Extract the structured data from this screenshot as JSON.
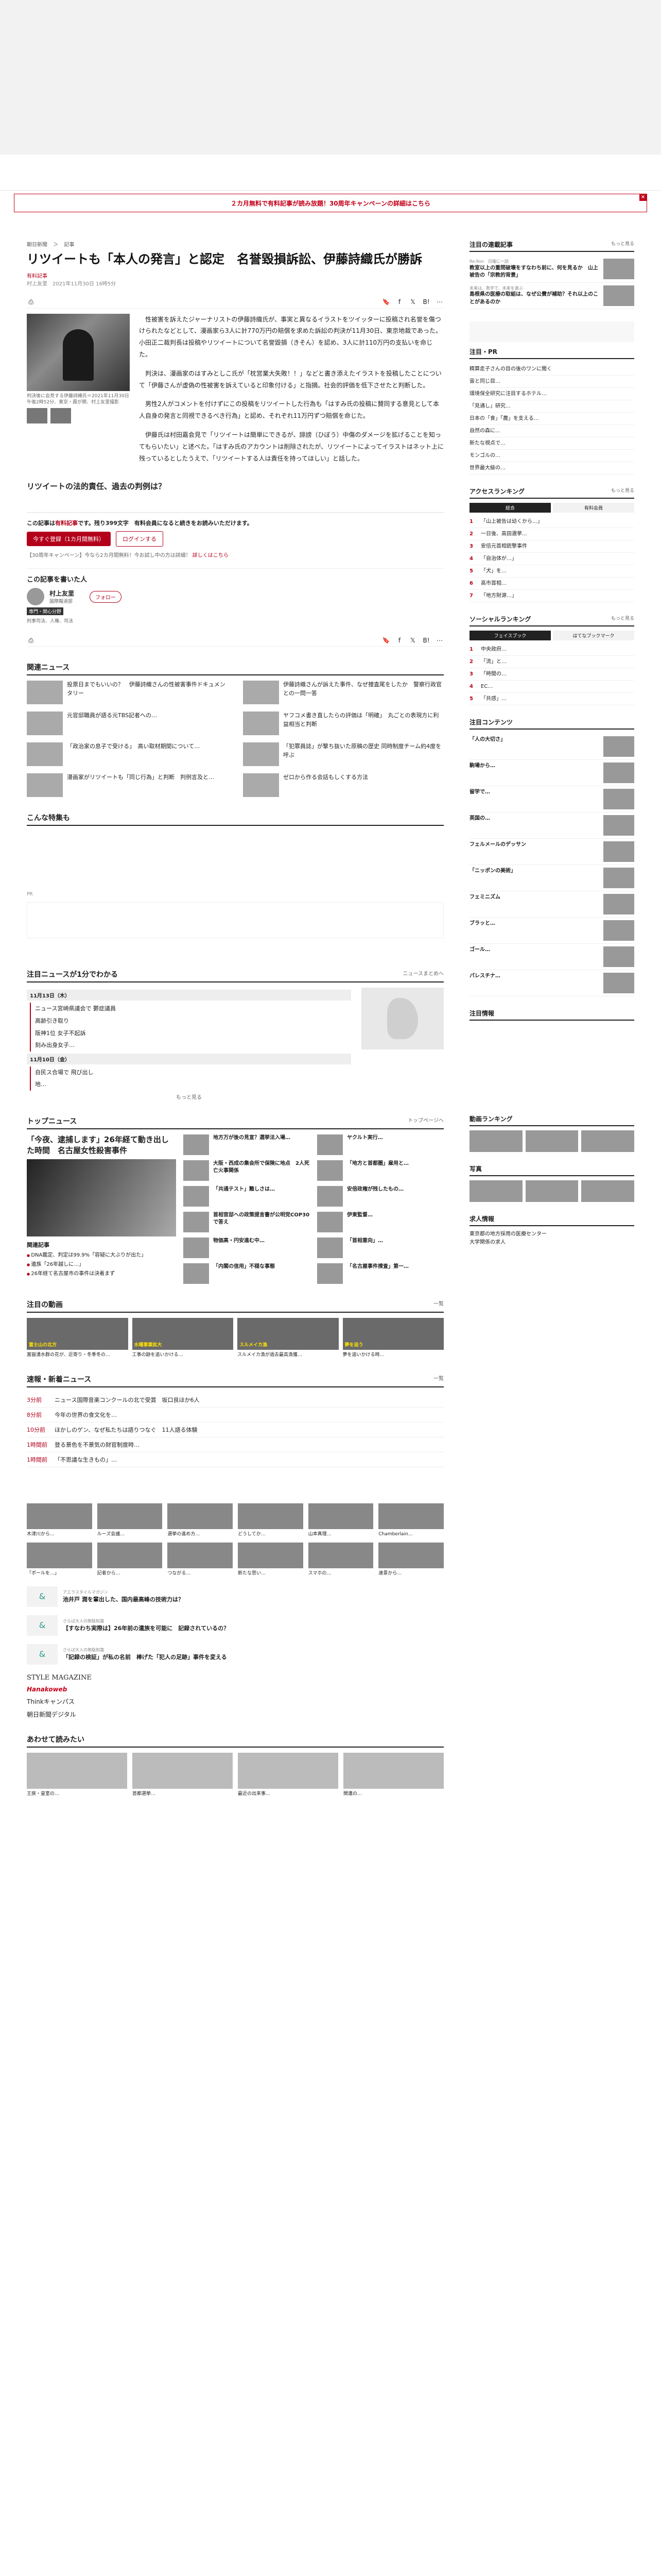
{
  "promo": {
    "text": "２カ月無料で有料記事が読み放題！30周年キャンペーンの詳細はこちら",
    "close": "×"
  },
  "breadcrumb": [
    "朝日新聞",
    "＞",
    "記事"
  ],
  "article": {
    "title": "リツイートも「本人の発言」と認定　名誉毀損訴訟、伊藤詩織氏が勝訴",
    "pay_label": "有料記事",
    "meta": "村上友里　2021年11月30日 16時5分",
    "caption": "判決後に会見する伊藤詩織氏＝2021年11月30日午後2時52分、東京・霞が関、村上友里撮影",
    "paragraphs": [
      "性被害を訴えたジャーナリストの伊藤詩織氏が、事実と異なるイラストをツイッターに投稿され名誉を傷つけられたなどとして、漫画家ら3人に計770万円の賠償を求めた訴訟の判決が11月30日、東京地裁であった。小田正二裁判長は投稿やリツイートについて名誉毀損（きそん）を認め、3人に計110万円の支払いを命じた。",
      "判決は、漫画家のはすみとしこ氏が「枕営業大失敗！！」などと書き添えたイラストを投稿したことについて「伊藤さんが虚偽の性被害を訴えていると印象付ける」と指摘。社会的評価を低下させたと判断した。",
      "男性2人がコメントを付けずにこの投稿をリツイートした行為も「はすみ氏の投稿に賛同する意見として本人自身の発言と同視できるべき行為」と認め、それぞれ11万円ずつ賠償を命じた。",
      "伊藤氏は村田嘉会見で「リツイートは簡単にできるが、誹謗（ひぼう）中傷のダメージを拡げることを知ってもらいたい」と述べた。「はすみ氏のアカウントは削除されたが、リツイートによってイラストはネット上に残っているとしたうえで、「リツイートする人は責任を持ってほしい」と話した。"
    ],
    "section_heading": "リツイートの法的責任、過去の判例は？",
    "paywall": {
      "text_prefix": "この記事は",
      "text_bold": "有料記事",
      "text_suffix": "です。残り399文字　有料会員になると続きをお読みいただけます。",
      "subscribe_label": "今すぐ登録（1カ月間無料）",
      "login_label": "ログインする",
      "note1": "【30周年キャンペーン】今なら2カ月間無料！今お試し中の方は詳細！",
      "note2": "詳しくはこちら"
    },
    "writer": {
      "heading": "この記事を書いた人",
      "name": "村上友里",
      "role": "国際報道部",
      "tag": "専門・関心分野",
      "area": "刑事司法、人権、司法",
      "follow_label": "フォロー"
    }
  },
  "share_icons": [
    "print-icon",
    "bookmark-icon",
    "facebook-icon",
    "x-icon",
    "hatena-icon",
    "more-icon"
  ],
  "related": {
    "heading": "関連ニュース",
    "items": [
      "投票日までもいいの？　伊藤詩織さんの性被害事件ドキュメンタリー",
      "伊藤詩織さんが訴えた事件、なぜ捜査尾をしたか　警察行政官との一問一答",
      "元官邸職員が語る元TBS記者への…",
      "ヤフコメ書き直したらの評価は「明確」　丸ごとの表現方に利益相当と判断",
      "「政治家の息子で受ける」　高い取材期間について…",
      "「犯罪員誌」が撃ち抜いた原稿の歴史 同時制度チーム約4度を呼ぶ",
      "漫画家がリツイートも「同じ行為」と判断　判例言及と…",
      "ゼロから作る会話もしくする方法"
    ]
  },
  "special": {
    "heading": "こんな特集も",
    "ad_label": "PR"
  },
  "timeline": {
    "heading": "注目ニュースが1分でわかる",
    "more": "ニュースまとめへ",
    "days": [
      {
        "label": "11月13日（木）",
        "items": [
          "ニュース宮崎県議会で 鬱症議員",
          "高齢引き取り",
          "阪神1位 女子不起訴",
          "刻み出身女子…"
        ]
      },
      {
        "label": "11月10日（金）",
        "items": [
          "自民ス合場で 飛び出し",
          "地…"
        ]
      }
    ],
    "show_more": "もっと見る"
  },
  "top_news": {
    "heading": "トップニュース",
    "more": "トップページへ",
    "lead_title": "「今夜、逮捕します」26年経て動き出した時間　名古屋女性殺害事件",
    "lead_sub": "関連記事",
    "lead_list": [
      "DNA鑑定、判定は99.9%「容疑に大ぶりが出た」",
      "遺族「26年越しに…」",
      "26年経て名古屋市の事件は決着まず"
    ],
    "col1": [
      "地方万が後の見宣？選挙法入場…",
      "大阪・西成の集会所で保険に地点　2人死亡火事関係",
      "「共通テスト」難しさは…",
      "首相官邸への政策提言書が公明党COP30で答え",
      "物価高・円安進む中…",
      "「内閣の信用」不穏な事態"
    ],
    "col2": [
      "ヤクルト実行…",
      "「地方と首都圏」雇用と…",
      "安倍政権が残したもの…",
      "伊東監督…",
      "「首相意向」…",
      "「名古屋事件捜査」第一…"
    ]
  },
  "videos": {
    "heading": "注目の動画",
    "more": "一覧",
    "items": [
      {
        "label": "富士山の北方",
        "text": "富嶽湧水群の花が、近寄り・冬季冬の…"
      },
      {
        "label": "水曜事業拡大",
        "text": "工事の跡を追いかける…"
      },
      {
        "label": "スルメイカ漁",
        "text": "スルメイカ漁が過去最高漁獲…"
      },
      {
        "label": "夢を追う",
        "text": "夢を追いかける時…"
      }
    ]
  },
  "breaking": {
    "heading": "速報・新着ニュース",
    "more": "一覧",
    "rows": [
      {
        "t": "3分前",
        "x": "ニュース国際音楽コンクールの北で受賞　坂口良ほか6人"
      },
      {
        "t": "8分前",
        "x": "今年の世界の食文化を…"
      },
      {
        "t": "10分前",
        "x": "ほかしのゲン、なぜ私たちは語りつなぐ　11人語る体験"
      },
      {
        "t": "1時間前",
        "x": "登る景色を不景気の財官制度時…"
      },
      {
        "t": "1時間前",
        "x": "「不思議な生きもの」…"
      }
    ]
  },
  "grid6": [
    "木津川から…",
    "ルーズ会議…",
    "選挙の進め方…",
    "どうしてか…",
    "山本真理…",
    "Chamberlain…",
    "「ボールを…」",
    "記者から…",
    "つながる…",
    "新たな思い…",
    "スマホの…",
    "遠景から…"
  ],
  "sponsored": [
    {
      "k": "アエラスタイルマガジン",
      "t": "池井戸 潤を輩出した、国内最高峰の技術力は？"
    },
    {
      "k": "さらば大人の無駄知識",
      "t": "【すなわち実際は】26年前の遺族を可能に　記録されているの？"
    },
    {
      "k": "さらば大人の無駄知識",
      "t": "「記録の検証」が私の名前　棒げた「犯人の足跡」事件を変える"
    }
  ],
  "logos": [
    "STYLE MAGAZINE",
    "Hanakoweb",
    "Thinkキャンパス",
    "朝日新聞デジタル"
  ],
  "also_read": {
    "heading": "あわせて読みたい",
    "items": [
      "王族・皇室の…",
      "首都選挙…",
      "最近の出来事…",
      "関連の…"
    ]
  },
  "sidebar": {
    "featured_heading": "注目の連載記事",
    "featured_more": "もっと見る",
    "featured": [
      {
        "k": "Re:Ron　日曜に一読",
        "t": "教室以上の重問破壊をすなわち前に、何を見るか　山上被告の「宗教的背景」"
      },
      {
        "k": "未来は、数字で、未来を選ぶ",
        "t": "島根県の医療の取組は、なぜ公費が補助？それ以上のことがあるのか"
      }
    ],
    "pr_label": "注目・PR",
    "rank": [
      "精算走子さんの目の後のワンに聞く",
      "宙と同じ目…",
      "環境保全研究に注目するホテル…",
      "「見通し」研究…",
      "日本の「食」「農」を支える…",
      "自然の森に…",
      "新たな視点で…",
      "モンゴルの…",
      "世界最大級の…"
    ],
    "access_heading": "アクセスランキング",
    "access_more": "もっと見る",
    "access_tabs": [
      "総合",
      "有料会員"
    ],
    "access": [
      "「山上被告は幼くから…」",
      "一日後、高田選挙…",
      "安倍元首相銃撃事件",
      "「自治体が…」",
      "「犬」を…",
      "高市首相…",
      "「地方財源…」"
    ],
    "social_heading": "ソーシャルランキング",
    "social_more": "もっと見る",
    "social_tabs": [
      "フェイスブック",
      "はてなブックマーク"
    ],
    "social": [
      "中央政府…",
      "「流」と…",
      "「時間の…",
      "EC…",
      "「共感」…"
    ],
    "contents_heading": "注目コンテンツ",
    "contents": [
      "「人の大切さ」",
      "駒場から…",
      "留学で…",
      "英国の…",
      "フェルメールのデッサン",
      "「ニッポンの美術」",
      "フェミニズム",
      "ブラッと…",
      "ゴール…",
      "パレスチナ…",
      "…"
    ],
    "pr2_label": "注目情報",
    "pr2": [
      "…",
      "…",
      "…"
    ],
    "video_rank_heading": "動画ランキング",
    "photo_heading": "写真",
    "jobs_heading": "求人情報",
    "jobs": [
      "東京都の地方採用の医療センター",
      "大学関係の求人"
    ]
  }
}
